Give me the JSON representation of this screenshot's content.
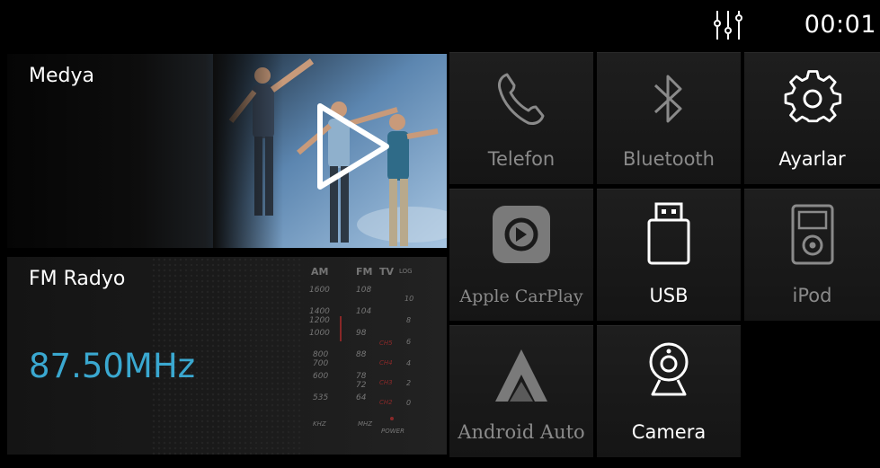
{
  "status": {
    "time": "00:01",
    "eq_icon": "equalizer-icon"
  },
  "media": {
    "title": "Medya",
    "play_icon": "play-icon"
  },
  "radio": {
    "title": "FM Radyo",
    "frequency": "87.50MHz",
    "dial": {
      "headers": [
        "AM",
        "FM",
        "TV",
        "LOG"
      ],
      "am": [
        "1600",
        "1400",
        "1200",
        "1000",
        "800",
        "700",
        "600",
        "535"
      ],
      "fm": [
        "108",
        "104",
        "98",
        "88",
        "78",
        "72",
        "64"
      ],
      "ch": [
        "CH5",
        "CH4",
        "CH3",
        "CH2"
      ],
      "log": [
        "10",
        "8",
        "6",
        "4",
        "2",
        "0"
      ],
      "footer": [
        "KHZ",
        "MHZ",
        "POWER"
      ]
    }
  },
  "apps": [
    {
      "label": "Telefon",
      "icon": "phone-icon",
      "style": "dim"
    },
    {
      "label": "Bluetooth",
      "icon": "bluetooth-icon",
      "style": "dim"
    },
    {
      "label": "Ayarlar",
      "icon": "gear-icon",
      "style": "bright"
    },
    {
      "label": "Apple CarPlay",
      "icon": "carplay-icon",
      "style": "dim"
    },
    {
      "label": "USB",
      "icon": "usb-icon",
      "style": "bright"
    },
    {
      "label": "iPod",
      "icon": "ipod-icon",
      "style": "dim"
    },
    {
      "label": "Android Auto",
      "icon": "android-auto-icon",
      "style": "dim"
    },
    {
      "label": "Camera",
      "icon": "camera-icon",
      "style": "bright"
    }
  ],
  "colors": {
    "frequency": "#3aa8d0",
    "background": "#000000"
  }
}
